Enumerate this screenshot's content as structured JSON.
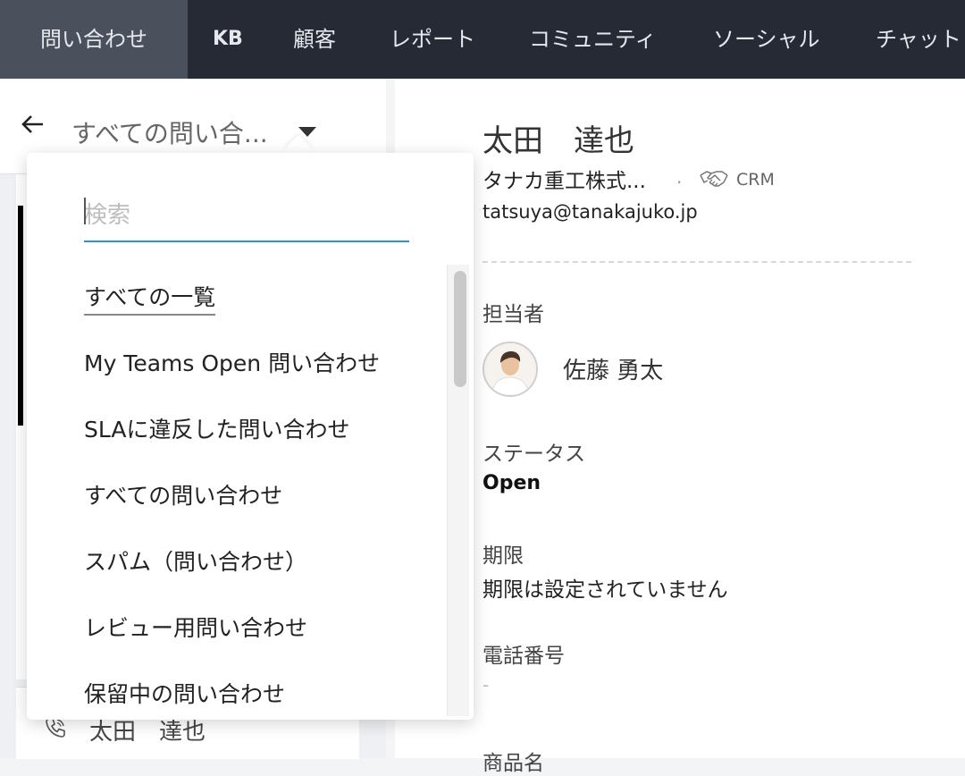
{
  "nav": {
    "tabs": [
      {
        "label": "問い合わせ",
        "active": true
      },
      {
        "label": "KB"
      },
      {
        "label": "顧客"
      },
      {
        "label": "レポート"
      },
      {
        "label": "コミュニティ"
      },
      {
        "label": "ソーシャル"
      },
      {
        "label": "チャット"
      }
    ]
  },
  "list_panel": {
    "view_title": "すべての問い合...",
    "bottom_item_name": "太田　達也"
  },
  "dropdown": {
    "search_placeholder": "検索",
    "items": [
      "すべての一覧",
      "My Teams Open 問い合わせ",
      "SLAに違反した問い合わせ",
      "すべての問い合わせ",
      "スパム（問い合わせ）",
      "レビュー用問い合わせ",
      "保留中の問い合わせ"
    ],
    "selected_index": 0
  },
  "contact": {
    "name": "太田　達也",
    "company": "タナカ重工株式...",
    "separator": ".",
    "crm_label": "CRM",
    "email": "tatsuya@tanakajuko.jp"
  },
  "details": {
    "assignee_label": "担当者",
    "assignee_name": "佐藤 勇太",
    "status_label": "ステータス",
    "status_value": "Open",
    "due_label": "期限",
    "due_value": "期限は設定されていません",
    "phone_label": "電話番号",
    "phone_value": "-",
    "next_label": "商品名"
  },
  "colors": {
    "nav_bg": "#252a35",
    "nav_active_bg": "#4a505c",
    "search_underline": "#2f8fd8"
  }
}
